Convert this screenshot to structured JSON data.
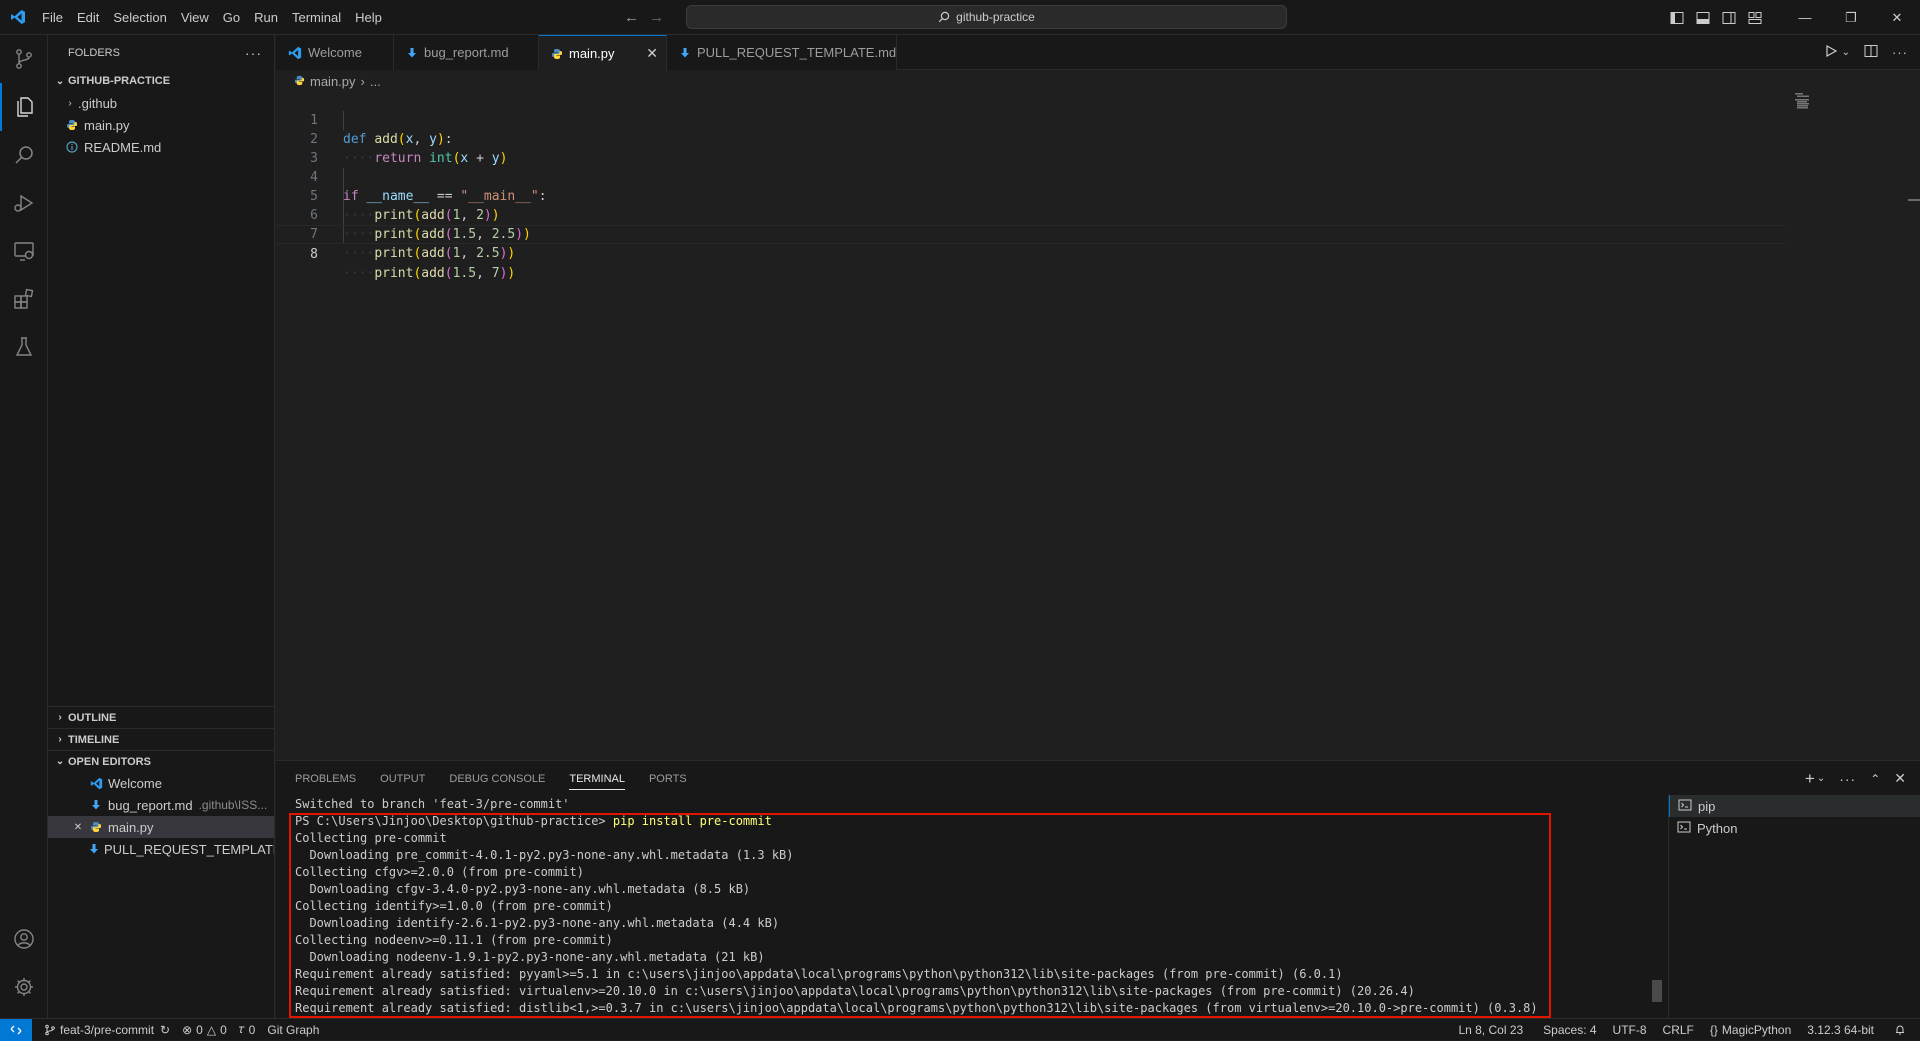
{
  "titlebar": {
    "menu": [
      "File",
      "Edit",
      "Selection",
      "View",
      "Go",
      "Run",
      "Terminal",
      "Help"
    ],
    "search_text": "github-practice"
  },
  "sidebar": {
    "title": "FOLDERS",
    "root": "GITHUB-PRACTICE",
    "items": [
      ".github",
      "main.py",
      "README.md"
    ],
    "sections": {
      "outline": "OUTLINE",
      "timeline": "TIMELINE",
      "open_editors": "OPEN EDITORS"
    },
    "open_editors": [
      {
        "name": "Welcome",
        "desc": ""
      },
      {
        "name": "bug_report.md",
        "desc": ".github\\ISS..."
      },
      {
        "name": "main.py",
        "desc": ""
      },
      {
        "name": "PULL_REQUEST_TEMPLATE...",
        "desc": ""
      }
    ]
  },
  "tabs": [
    "Welcome",
    "bug_report.md",
    "main.py",
    "PULL_REQUEST_TEMPLATE.md"
  ],
  "breadcrumb": {
    "file": "main.py",
    "rest": "..."
  },
  "editor": {
    "line_numbers": [
      "1",
      "2",
      "3",
      "4",
      "5",
      "6",
      "7",
      "8"
    ],
    "lines": [
      "def add(x, y):",
      "    return int(x + y)",
      "",
      "if __name__ == \"__main__\":",
      "    print(add(1, 2))",
      "    print(add(1.5, 2.5))",
      "    print(add(1, 2.5))",
      "    print(add(1.5, 7))"
    ]
  },
  "panel": {
    "tabs": [
      "PROBLEMS",
      "OUTPUT",
      "DEBUG CONSOLE",
      "TERMINAL",
      "PORTS"
    ],
    "terminal_prompt": "PS C:\\Users\\Jinjoo\\Desktop\\github-practice> ",
    "terminal_command": "pip install pre-commit",
    "terminal_lines": [
      "Switched to branch 'feat-3/pre-commit'",
      "Collecting pre-commit",
      "  Downloading pre_commit-4.0.1-py2.py3-none-any.whl.metadata (1.3 kB)",
      "Collecting cfgv>=2.0.0 (from pre-commit)",
      "  Downloading cfgv-3.4.0-py2.py3-none-any.whl.metadata (8.5 kB)",
      "Collecting identify>=1.0.0 (from pre-commit)",
      "  Downloading identify-2.6.1-py2.py3-none-any.whl.metadata (4.4 kB)",
      "Collecting nodeenv>=0.11.1 (from pre-commit)",
      "  Downloading nodeenv-1.9.1-py2.py3-none-any.whl.metadata (21 kB)",
      "Requirement already satisfied: pyyaml>=5.1 in c:\\users\\jinjoo\\appdata\\local\\programs\\python\\python312\\lib\\site-packages (from pre-commit) (6.0.1)",
      "Requirement already satisfied: virtualenv>=20.10.0 in c:\\users\\jinjoo\\appdata\\local\\programs\\python\\python312\\lib\\site-packages (from pre-commit) (20.26.4)",
      "Requirement already satisfied: distlib<1,>=0.3.7 in c:\\users\\jinjoo\\appdata\\local\\programs\\python\\python312\\lib\\site-packages (from virtualenv>=20.10.0->pre-commit) (0.3.8)"
    ],
    "terminals": [
      "pip",
      "Python"
    ]
  },
  "statusbar": {
    "branch": "feat-3/pre-commit",
    "errors": "0",
    "warnings": "0",
    "ports": "0",
    "git_graph": "Git Graph",
    "position": "Ln 8, Col 23",
    "spaces": "Spaces: 4",
    "encoding": "UTF-8",
    "eol": "CRLF",
    "language": "MagicPython",
    "interpreter": "3.12.3 64-bit"
  },
  "colors": {
    "accent": "#0078d4",
    "highlight_box": "#e51400"
  }
}
